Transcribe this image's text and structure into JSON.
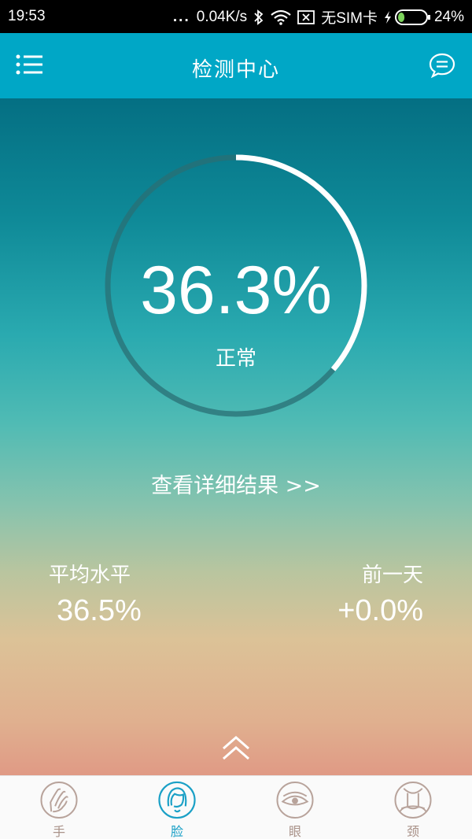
{
  "status_bar": {
    "time": "19:53",
    "dots": "...",
    "net_speed": "0.04K/s",
    "sim": "无SIM卡",
    "battery": "24%",
    "battery_level": 0.24
  },
  "app_bar": {
    "title": "检测中心",
    "menu_icon": "list-menu-icon",
    "chat_icon": "chat-bubble-icon"
  },
  "gauge": {
    "value_text": "36.3%",
    "value": 0.363,
    "status": "正常"
  },
  "details_link": "查看详细结果 >>",
  "stats": {
    "average": {
      "label": "平均水平",
      "value": "36.5%"
    },
    "previous_day": {
      "label": "前一天",
      "value": "+0.0%"
    }
  },
  "bottom_nav": [
    {
      "label": "手",
      "icon": "hand-icon",
      "active": false
    },
    {
      "label": "脸",
      "icon": "face-icon",
      "active": true
    },
    {
      "label": "眼",
      "icon": "eye-icon",
      "active": false
    },
    {
      "label": "颈",
      "icon": "neck-icon",
      "active": false
    }
  ],
  "colors": {
    "app_bar": "#00a7c6",
    "accent": "#1aa0c6",
    "inactive": "#a99289"
  }
}
